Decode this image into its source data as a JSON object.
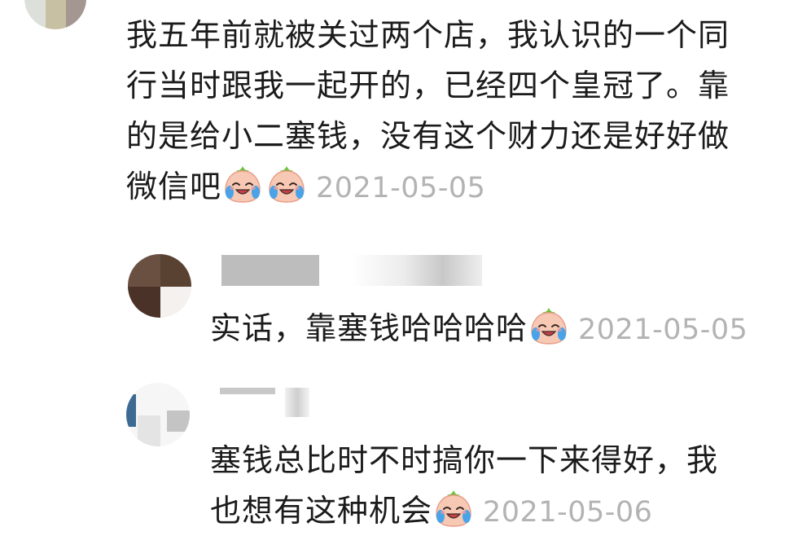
{
  "comments": [
    {
      "lines": [
        "我五年前就被关过两个店，我认识的一个同",
        "行当时跟我一起开的，已经四个皇冠了。靠",
        "的是给小二塞钱，没有这个财力还是好好做",
        "微信吧"
      ],
      "emoji": [
        "crying-laughing-peach-icon",
        "crying-laughing-peach-icon"
      ],
      "date": "2021-05-05"
    }
  ],
  "replies": [
    {
      "lines": [
        "实话，靠塞钱哈哈哈哈"
      ],
      "emoji": [
        "crying-laughing-peach-icon"
      ],
      "date": "2021-05-05"
    },
    {
      "lines": [
        "塞钱总比时不时搞你一下来得好，我",
        "也想有这种机会"
      ],
      "emoji": [
        "crying-laughing-peach-icon"
      ],
      "date": "2021-05-06"
    }
  ],
  "colors": {
    "text": "#1b1b1b",
    "date": "#b3b3b3",
    "emoji_face": "#f7c9b4",
    "emoji_tear": "#4aa3e8",
    "emoji_leaf": "#6cbf3a"
  }
}
